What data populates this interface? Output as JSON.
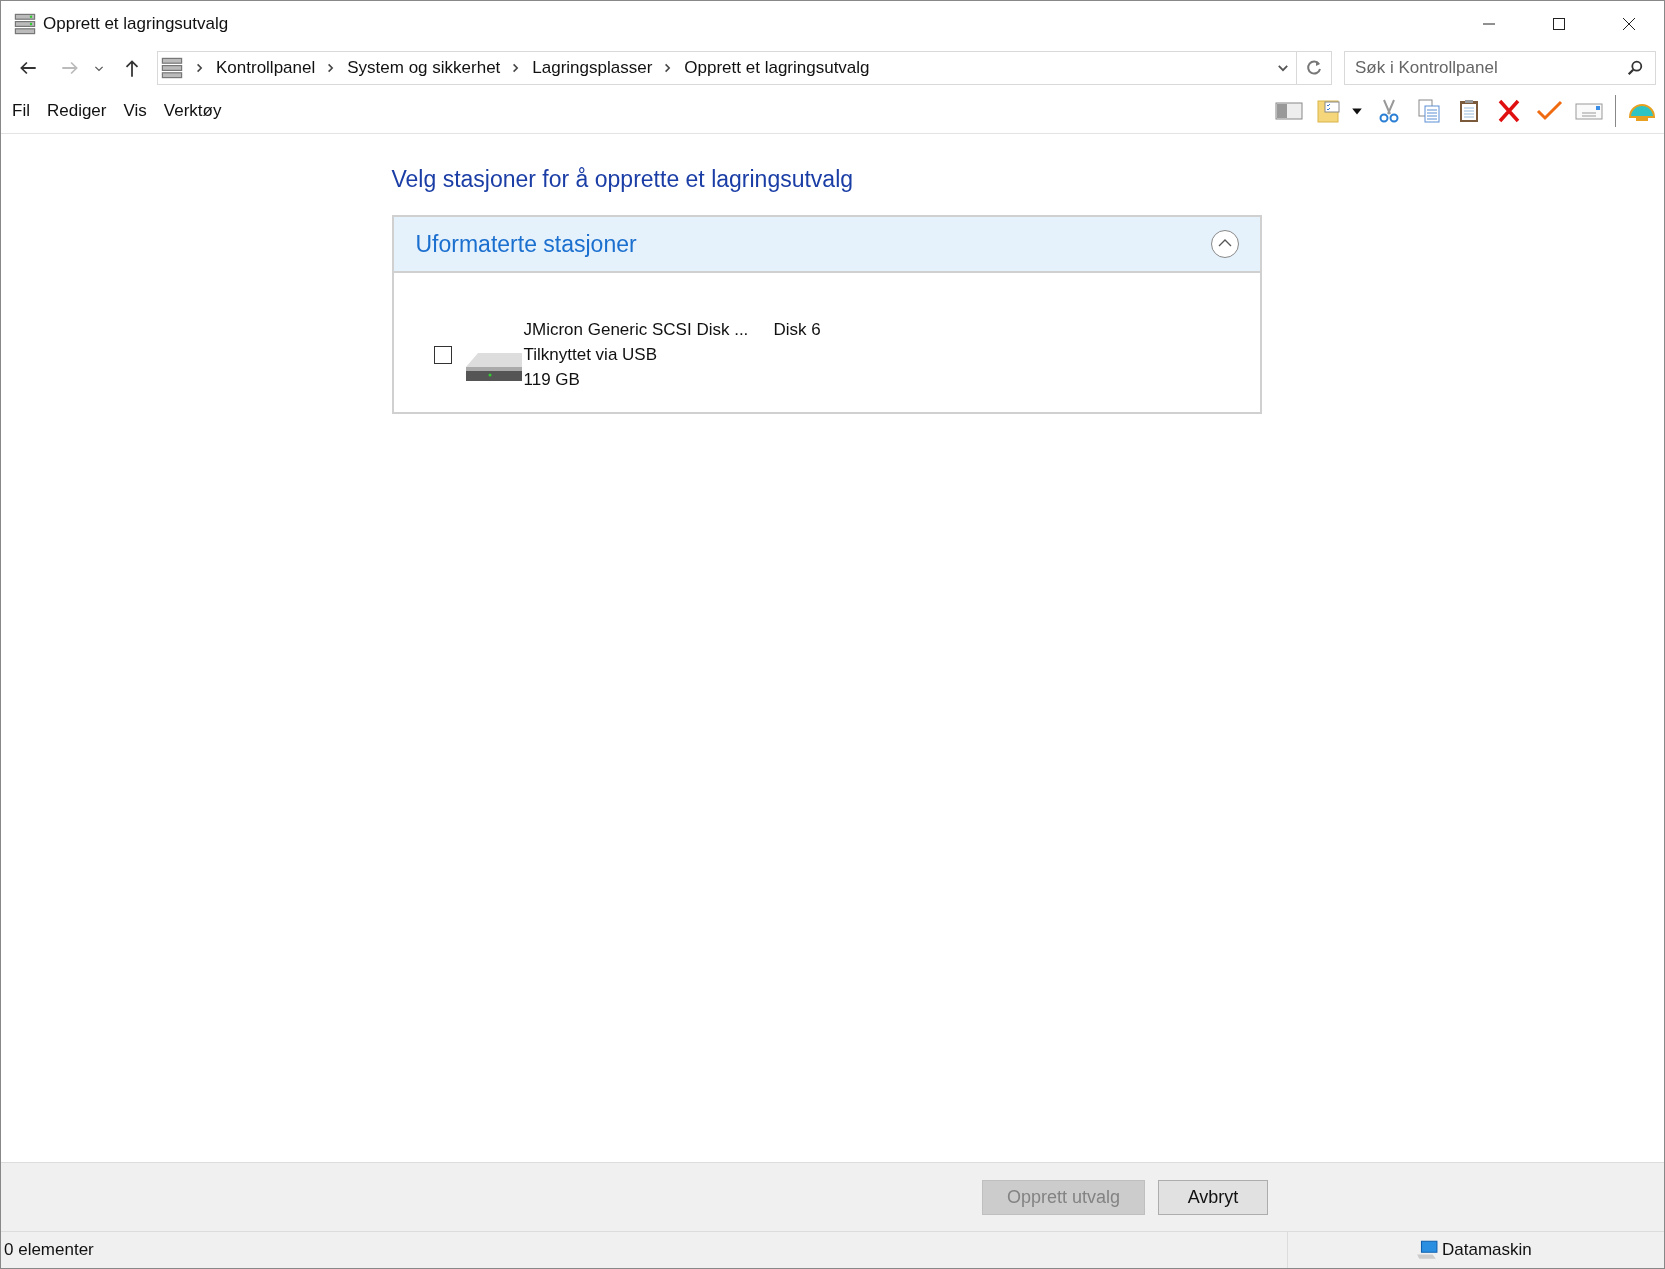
{
  "window": {
    "title": "Opprett et lagringsutvalg"
  },
  "address_bar": {
    "breadcrumb": [
      "Kontrollpanel",
      "System og sikkerhet",
      "Lagringsplasser",
      "Opprett et lagringsutvalg"
    ]
  },
  "search": {
    "placeholder": "Søk i Kontrollpanel"
  },
  "menu": [
    "Fil",
    "Rediger",
    "Vis",
    "Verktøy"
  ],
  "heading": "Velg stasjoner for å opprette et lagringsutvalg",
  "group": {
    "title": "Uformaterte stasjoner",
    "expanded": true,
    "drives": [
      {
        "name": "JMicron Generic SCSI Disk ...",
        "disk": "Disk 6",
        "connection": "Tilknyttet via USB",
        "size": "119 GB",
        "checked": false
      }
    ]
  },
  "buttons": [
    {
      "label": "Opprett utvalg",
      "disabled": true
    },
    {
      "label": "Avbryt",
      "disabled": false
    }
  ],
  "status_bar": {
    "items": "0 elementer",
    "location": "Datamaskin"
  }
}
